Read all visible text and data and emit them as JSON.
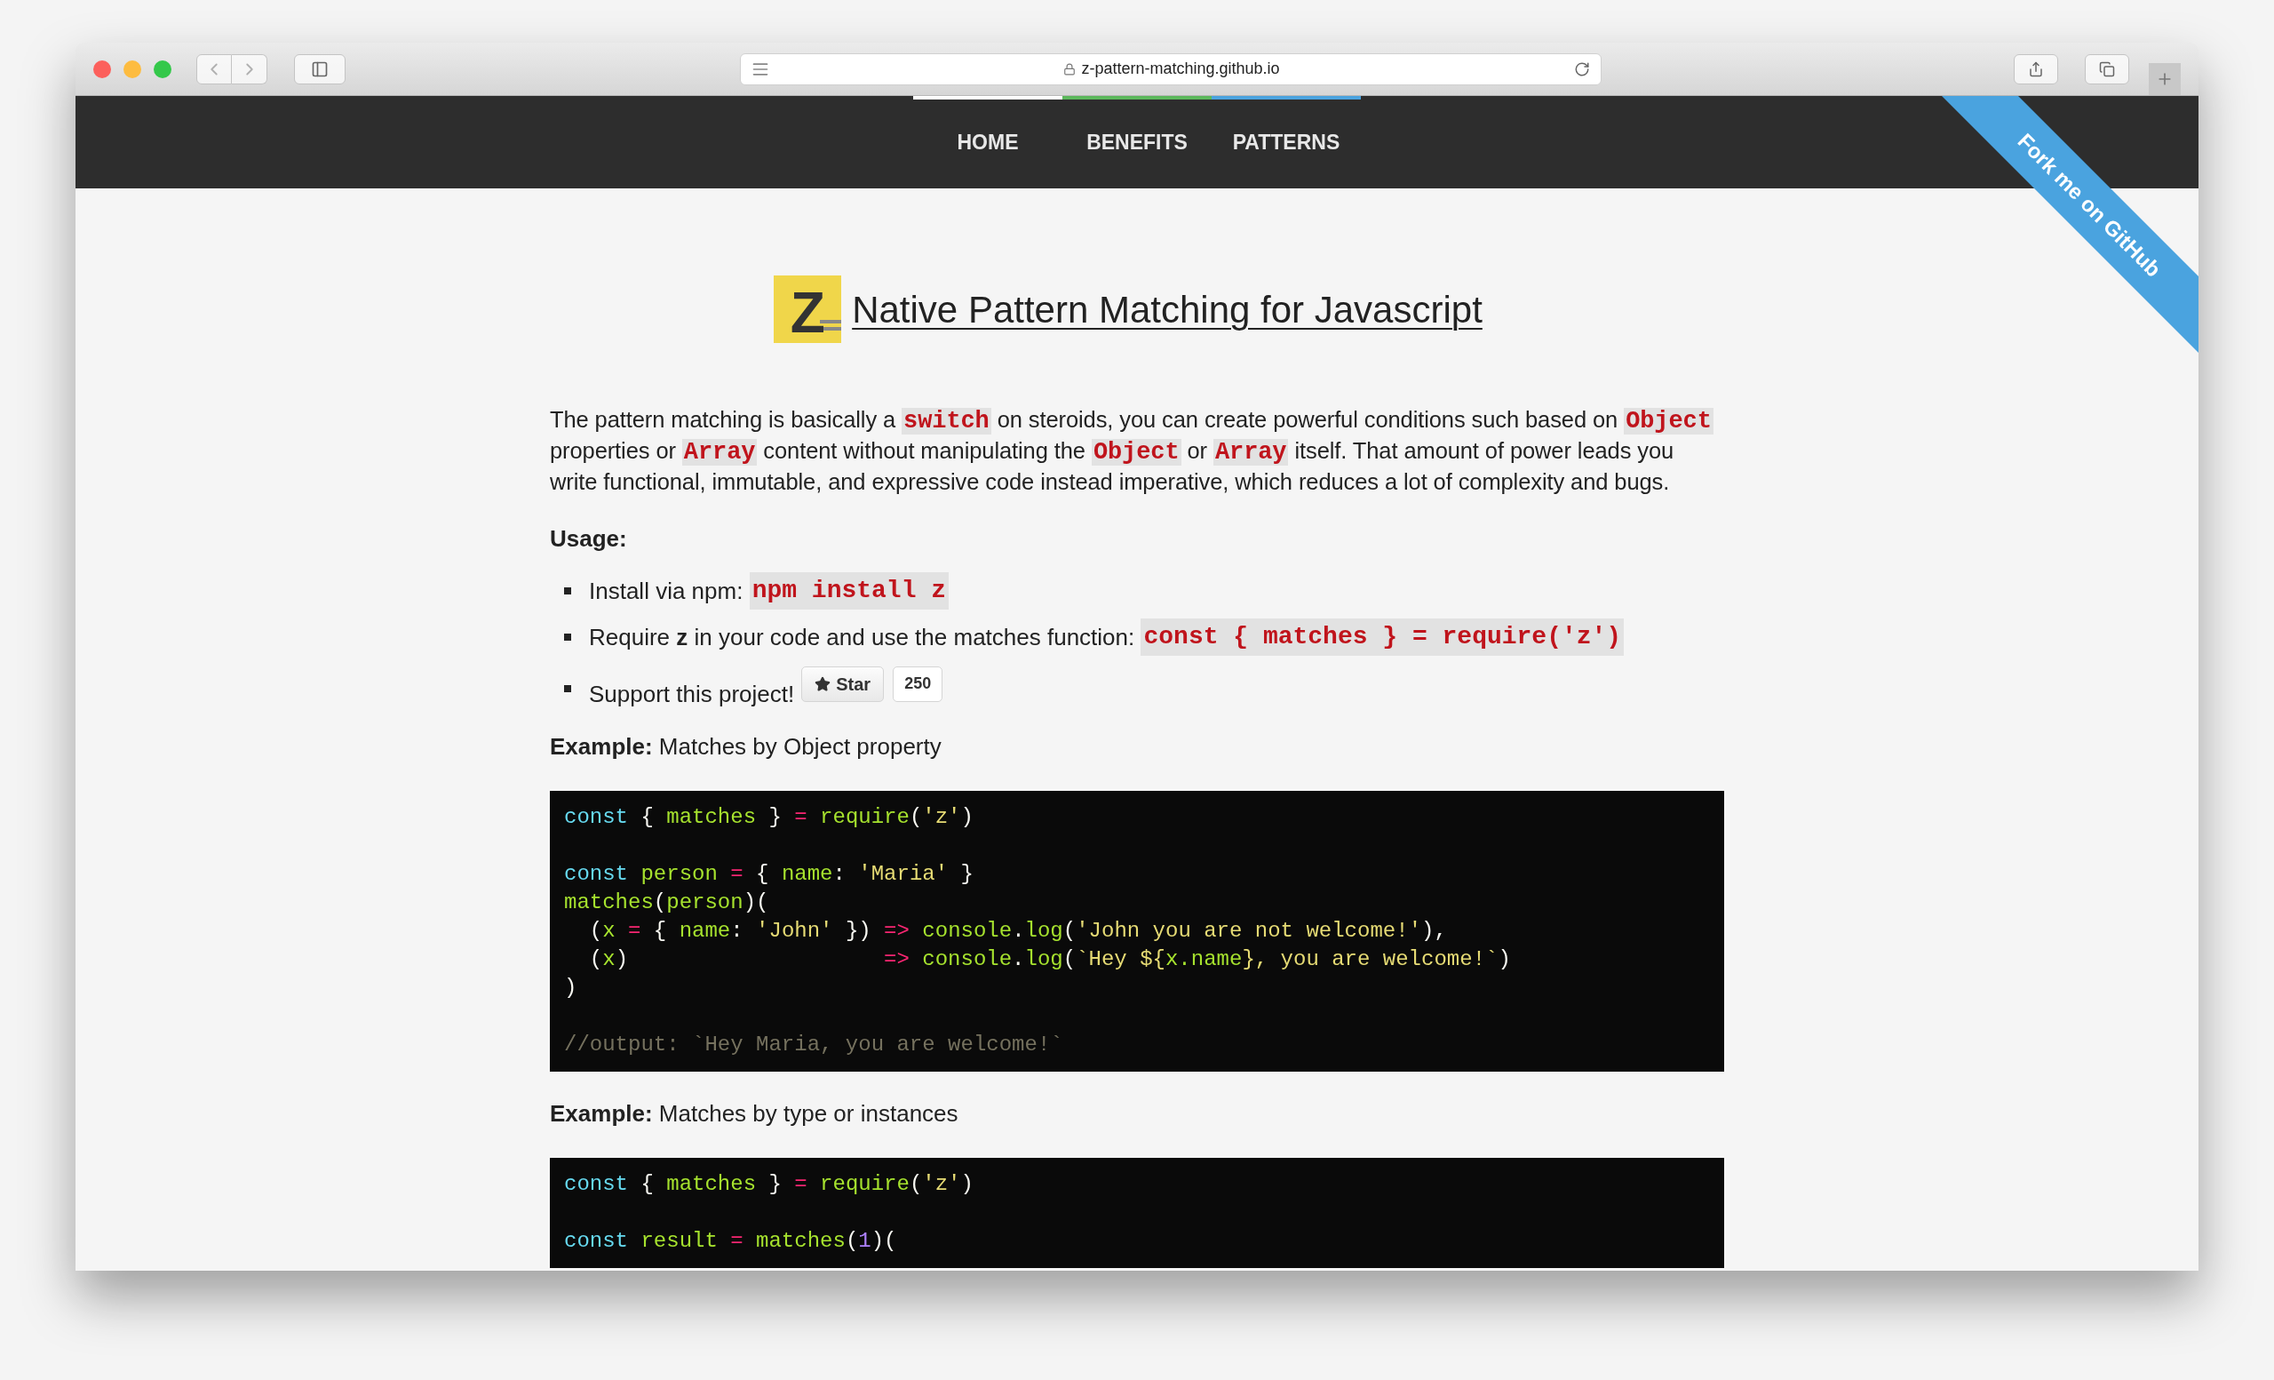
{
  "browser": {
    "url": "z-pattern-matching.github.io"
  },
  "nav": {
    "items": [
      {
        "label": "HOME",
        "color": "#ffffff"
      },
      {
        "label": "BENEFITS",
        "color": "#5cb85c"
      },
      {
        "label": "PATTERNS",
        "color": "#4aa3df"
      }
    ],
    "ribbon": "Fork me on GitHub"
  },
  "header": {
    "logo": "Z",
    "title": "Native Pattern Matching for Javascript"
  },
  "intro": [
    {
      "kind": "text",
      "text": "The pattern matching is basically a "
    },
    {
      "kind": "code",
      "text": "switch"
    },
    {
      "kind": "text",
      "text": " on steroids, you can create powerful conditions such based on "
    },
    {
      "kind": "code",
      "text": "Object"
    },
    {
      "kind": "text",
      "text": " properties or "
    },
    {
      "kind": "code",
      "text": "Array"
    },
    {
      "kind": "text",
      "text": " content without manipulating the "
    },
    {
      "kind": "code",
      "text": "Object"
    },
    {
      "kind": "text",
      "text": " or "
    },
    {
      "kind": "code",
      "text": "Array"
    },
    {
      "kind": "text",
      "text": " itself. That amount of power leads you write functional, immutable, and expressive code instead imperative, which reduces a lot of complexity and bugs."
    }
  ],
  "usage": {
    "heading": "Usage:",
    "items": [
      {
        "kind": "code",
        "text": "Install via npm: ",
        "code": "npm install z"
      },
      {
        "kind": "code",
        "text": "Require **z** in your code and use the matches function: ",
        "code": "const { matches } = require('z')"
      },
      {
        "kind": "star",
        "text": "Support this project!",
        "button": "Star",
        "count": "250"
      }
    ]
  },
  "examples": [
    {
      "label": "Example:",
      "caption": " Matches by Object property",
      "lines": [
        {
          "kind": "code",
          "tokens": [
            {
              "kind": "kw",
              "text": "const"
            },
            {
              "kind": "pun",
              "text": " { "
            },
            {
              "kind": "id",
              "text": "matches"
            },
            {
              "kind": "pun",
              "text": " } "
            },
            {
              "kind": "op",
              "text": "="
            },
            {
              "kind": "id",
              "text": " require"
            },
            {
              "kind": "pun",
              "text": "("
            },
            {
              "kind": "str",
              "text": "'z'"
            },
            {
              "kind": "pun",
              "text": ")"
            }
          ]
        },
        {
          "kind": "blank"
        },
        {
          "kind": "code",
          "tokens": [
            {
              "kind": "kw",
              "text": "const"
            },
            {
              "kind": "id",
              "text": " person"
            },
            {
              "kind": "op",
              "text": " ="
            },
            {
              "kind": "pun",
              "text": " { "
            },
            {
              "kind": "id",
              "text": "name"
            },
            {
              "kind": "pun",
              "text": ": "
            },
            {
              "kind": "str",
              "text": "'Maria'"
            },
            {
              "kind": "pun",
              "text": " }"
            }
          ]
        },
        {
          "kind": "code",
          "tokens": [
            {
              "kind": "id",
              "text": "matches"
            },
            {
              "kind": "pun",
              "text": "("
            },
            {
              "kind": "id",
              "text": "person"
            },
            {
              "kind": "pun",
              "text": ")("
            }
          ]
        },
        {
          "kind": "code",
          "tokens": [
            {
              "kind": "pun",
              "text": "  ("
            },
            {
              "kind": "id",
              "text": "x"
            },
            {
              "kind": "op",
              "text": " ="
            },
            {
              "kind": "pun",
              "text": " { "
            },
            {
              "kind": "id",
              "text": "name"
            },
            {
              "kind": "pun",
              "text": ": "
            },
            {
              "kind": "str",
              "text": "'John'"
            },
            {
              "kind": "pun",
              "text": " }) "
            },
            {
              "kind": "op",
              "text": "=>"
            },
            {
              "kind": "id",
              "text": " console"
            },
            {
              "kind": "pun",
              "text": "."
            },
            {
              "kind": "id",
              "text": "log"
            },
            {
              "kind": "pun",
              "text": "("
            },
            {
              "kind": "str",
              "text": "'John you are not welcome!'"
            },
            {
              "kind": "pun",
              "text": "),"
            }
          ]
        },
        {
          "kind": "code",
          "tokens": [
            {
              "kind": "pun",
              "text": "  ("
            },
            {
              "kind": "id",
              "text": "x"
            },
            {
              "kind": "pun",
              "text": ")                    "
            },
            {
              "kind": "op",
              "text": "=>"
            },
            {
              "kind": "id",
              "text": " console"
            },
            {
              "kind": "pun",
              "text": "."
            },
            {
              "kind": "id",
              "text": "log"
            },
            {
              "kind": "pun",
              "text": "("
            },
            {
              "kind": "str",
              "text": "`Hey ${"
            },
            {
              "kind": "id",
              "text": "x.name"
            },
            {
              "kind": "str",
              "text": "}, you are welcome!`"
            },
            {
              "kind": "pun",
              "text": ")"
            }
          ]
        },
        {
          "kind": "code",
          "tokens": [
            {
              "kind": "pun",
              "text": ")"
            }
          ]
        },
        {
          "kind": "blank"
        },
        {
          "kind": "code",
          "tokens": [
            {
              "kind": "com",
              "text": "//output: `Hey Maria, you are welcome!`"
            }
          ]
        }
      ]
    },
    {
      "label": "Example:",
      "caption": " Matches by type or instances",
      "lines": [
        {
          "kind": "code",
          "tokens": [
            {
              "kind": "kw",
              "text": "const"
            },
            {
              "kind": "pun",
              "text": " { "
            },
            {
              "kind": "id",
              "text": "matches"
            },
            {
              "kind": "pun",
              "text": " } "
            },
            {
              "kind": "op",
              "text": "="
            },
            {
              "kind": "id",
              "text": " require"
            },
            {
              "kind": "pun",
              "text": "("
            },
            {
              "kind": "str",
              "text": "'z'"
            },
            {
              "kind": "pun",
              "text": ")"
            }
          ]
        },
        {
          "kind": "blank"
        },
        {
          "kind": "code",
          "tokens": [
            {
              "kind": "kw",
              "text": "const"
            },
            {
              "kind": "id",
              "text": " result"
            },
            {
              "kind": "op",
              "text": " ="
            },
            {
              "kind": "id",
              "text": " matches"
            },
            {
              "kind": "pun",
              "text": "("
            },
            {
              "kind": "num",
              "text": "1"
            },
            {
              "kind": "pun",
              "text": ")("
            }
          ]
        }
      ]
    }
  ]
}
